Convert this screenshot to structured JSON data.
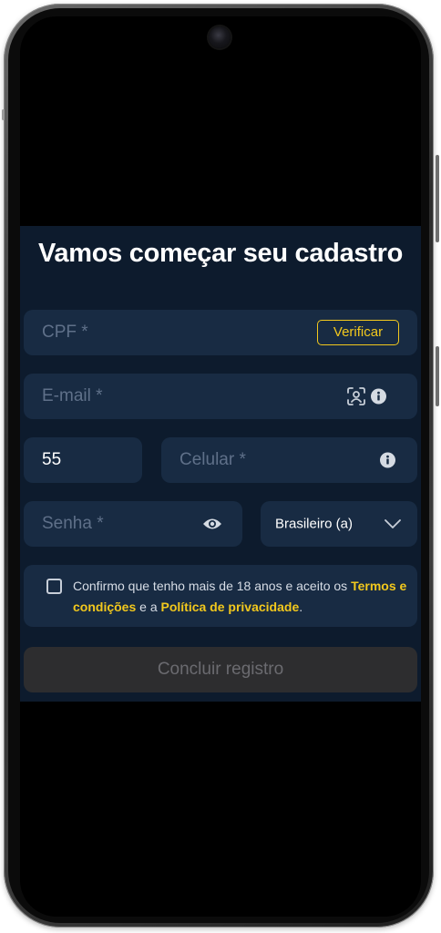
{
  "form": {
    "title": "Vamos começar seu cadastro",
    "cpf": {
      "placeholder": "CPF *",
      "verify_label": "Verificar"
    },
    "email": {
      "placeholder": "E-mail *"
    },
    "phone": {
      "country_code": "55",
      "placeholder": "Celular *"
    },
    "password": {
      "placeholder": "Senha *"
    },
    "nationality": {
      "selected": "Brasileiro (a)"
    },
    "consent": {
      "text_before": "Confirmo que tenho mais de 18 anos e aceito os ",
      "terms_link": "Termos e condições",
      "text_middle": " e a ",
      "privacy_link": "Política de privacidade",
      "text_after": "."
    },
    "submit_label": "Concluir registro"
  },
  "colors": {
    "panel_bg": "#0d1b2d",
    "field_bg": "#182b43",
    "accent": "#f2c81d",
    "placeholder": "#5f7089",
    "disabled_button_bg": "#2d2d2f"
  },
  "icons": {
    "face_scan": "face-scan-icon",
    "info": "info-icon",
    "eye": "eye-icon",
    "chevron": "chevron-down-icon",
    "camera": "front-camera"
  }
}
